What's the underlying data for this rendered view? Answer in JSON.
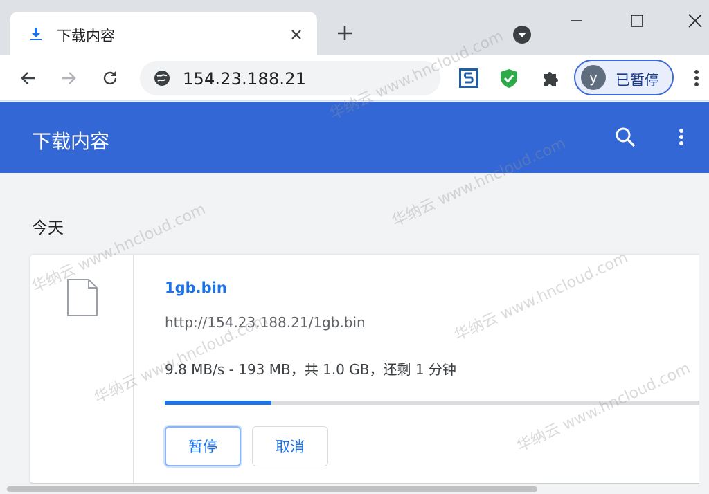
{
  "tab": {
    "title": "下载内容"
  },
  "omnibox": {
    "url": "154.23.188.21"
  },
  "profile": {
    "initial": "y",
    "label": "已暂停"
  },
  "page": {
    "title": "下载内容",
    "section_date": "今天"
  },
  "download": {
    "file_name": "1gb.bin",
    "url": "http://154.23.188.21/1gb.bin",
    "status": "9.8 MB/s - 193 MB，共 1.0 GB，还剩 1 分钟",
    "progress_fraction": 0.193,
    "pause_label": "暂停",
    "cancel_label": "取消"
  },
  "watermark": {
    "text": "华纳云 www.hncloud.com"
  },
  "colors": {
    "accent": "#1a73e8",
    "header": "#3367d6"
  },
  "icons": [
    "download-icon",
    "close-icon",
    "plus-icon",
    "tab-search-icon",
    "minimize-icon",
    "maximize-icon",
    "window-close-icon",
    "back-icon",
    "forward-icon",
    "reload-icon",
    "globe-icon",
    "extension-s-icon",
    "shield-check-icon",
    "puzzle-icon",
    "more-vert-icon",
    "search-icon",
    "file-icon"
  ]
}
